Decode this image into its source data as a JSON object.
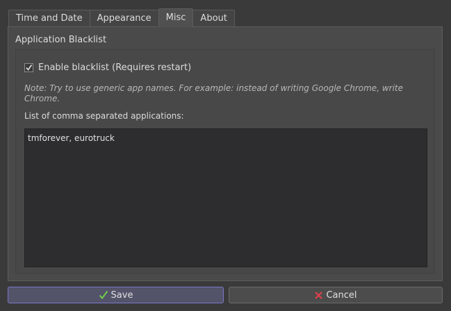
{
  "tabs": [
    {
      "label": "Time and Date"
    },
    {
      "label": "Appearance"
    },
    {
      "label": "Misc"
    },
    {
      "label": "About"
    }
  ],
  "active_tab": "Misc",
  "group": {
    "title": "Application Blacklist",
    "checkbox_label": "Enable blacklist (Requires restart)",
    "checkbox_checked": true,
    "note": "Note: Try to use generic app names. For example: instead of writing Google Chrome, write Chrome.",
    "list_label": "List of comma separated applications:",
    "list_value": "tmforever, eurotruck"
  },
  "buttons": {
    "save_label": "Save",
    "save_icon": "check-icon",
    "cancel_label": "Cancel",
    "cancel_icon": "x-icon"
  },
  "colors": {
    "accent": "#7a78c8",
    "check_green": "#6fcf4a",
    "cancel_red": "#e0404a"
  }
}
